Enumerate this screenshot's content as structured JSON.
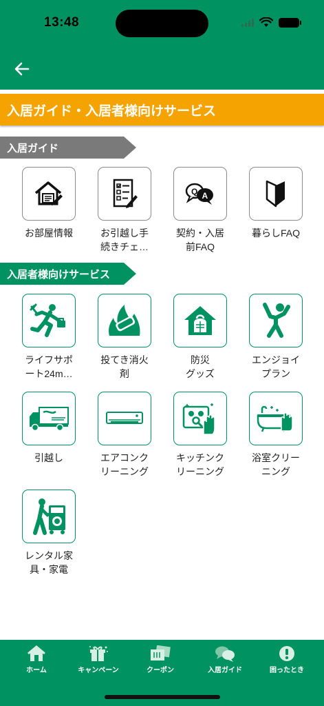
{
  "status": {
    "time": "13:48"
  },
  "header": {
    "title": "入居ガイド・入居者様向けサービス"
  },
  "sections": [
    {
      "title": "入居ガイド"
    },
    {
      "title": "入居者様向けサービス"
    }
  ],
  "guide_items": [
    {
      "label": "お部屋情報",
      "icon": "house-document-icon"
    },
    {
      "label": "お引越し手\n続きチェ…",
      "icon": "checklist-icon"
    },
    {
      "label": "契約・入居\n前FAQ",
      "icon": "qa-bubbles-icon"
    },
    {
      "label": "暮らしFAQ",
      "icon": "beginner-mark-icon"
    }
  ],
  "service_items": [
    {
      "label": "ライフサポ\nート24m…",
      "icon": "support-runner-icon"
    },
    {
      "label": "投てき消火\n剤",
      "icon": "fire-extinguisher-icon"
    },
    {
      "label": "防災\nグッズ",
      "icon": "emergency-bag-icon"
    },
    {
      "label": "エンジョイ\nプラン",
      "icon": "enjoy-person-icon"
    },
    {
      "label": "引越し",
      "icon": "moving-truck-icon"
    },
    {
      "label": "エアコンク\nリーニング",
      "icon": "air-conditioner-icon"
    },
    {
      "label": "キッチンク\nリーニング",
      "icon": "kitchen-cleaning-icon"
    },
    {
      "label": "浴室クリー\nニング",
      "icon": "bathtub-icon"
    },
    {
      "label": "レンタル家\n具・家電",
      "icon": "rental-appliance-icon"
    }
  ],
  "tabs": [
    {
      "label": "ホーム",
      "icon": "home-icon"
    },
    {
      "label": "キャンペーン",
      "icon": "gift-icon"
    },
    {
      "label": "クーポン",
      "icon": "coupon-icon"
    },
    {
      "label": "入居ガイド",
      "icon": "chat-bubbles-icon"
    },
    {
      "label": "困ったとき",
      "icon": "alert-icon"
    }
  ],
  "colors": {
    "brand_green": "#009260",
    "banner_orange": "#f4a300",
    "section_gray": "#7a7a7a"
  }
}
